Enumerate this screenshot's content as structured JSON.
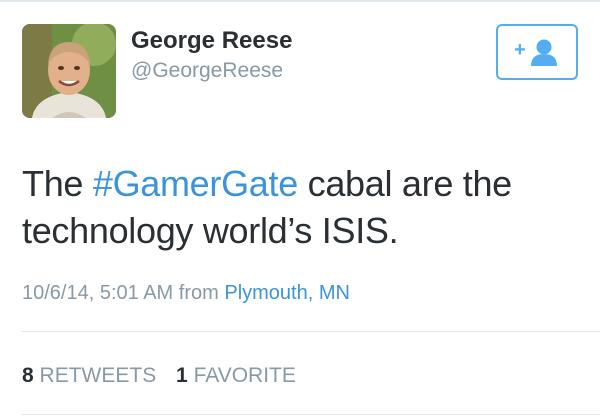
{
  "user": {
    "display_name": "George Reese",
    "handle": "@GeorgeReese"
  },
  "follow_button": {
    "icon": "add-user-icon",
    "plus": "+"
  },
  "tweet": {
    "text_before": "The ",
    "hashtag": "#GamerGate",
    "text_after": " cabal are the technology world’s ISIS."
  },
  "meta": {
    "timestamp": "10/6/14, 5:01 AM",
    "from_label": "from",
    "location": "Plymouth, MN"
  },
  "stats": {
    "retweets_count": "8",
    "retweets_label": "RETWEETS",
    "favorites_count": "1",
    "favorites_label": "FAVORITE"
  },
  "colors": {
    "accent": "#55acee",
    "link": "#3b94d9",
    "muted": "#8899a6",
    "text": "#292f33"
  }
}
